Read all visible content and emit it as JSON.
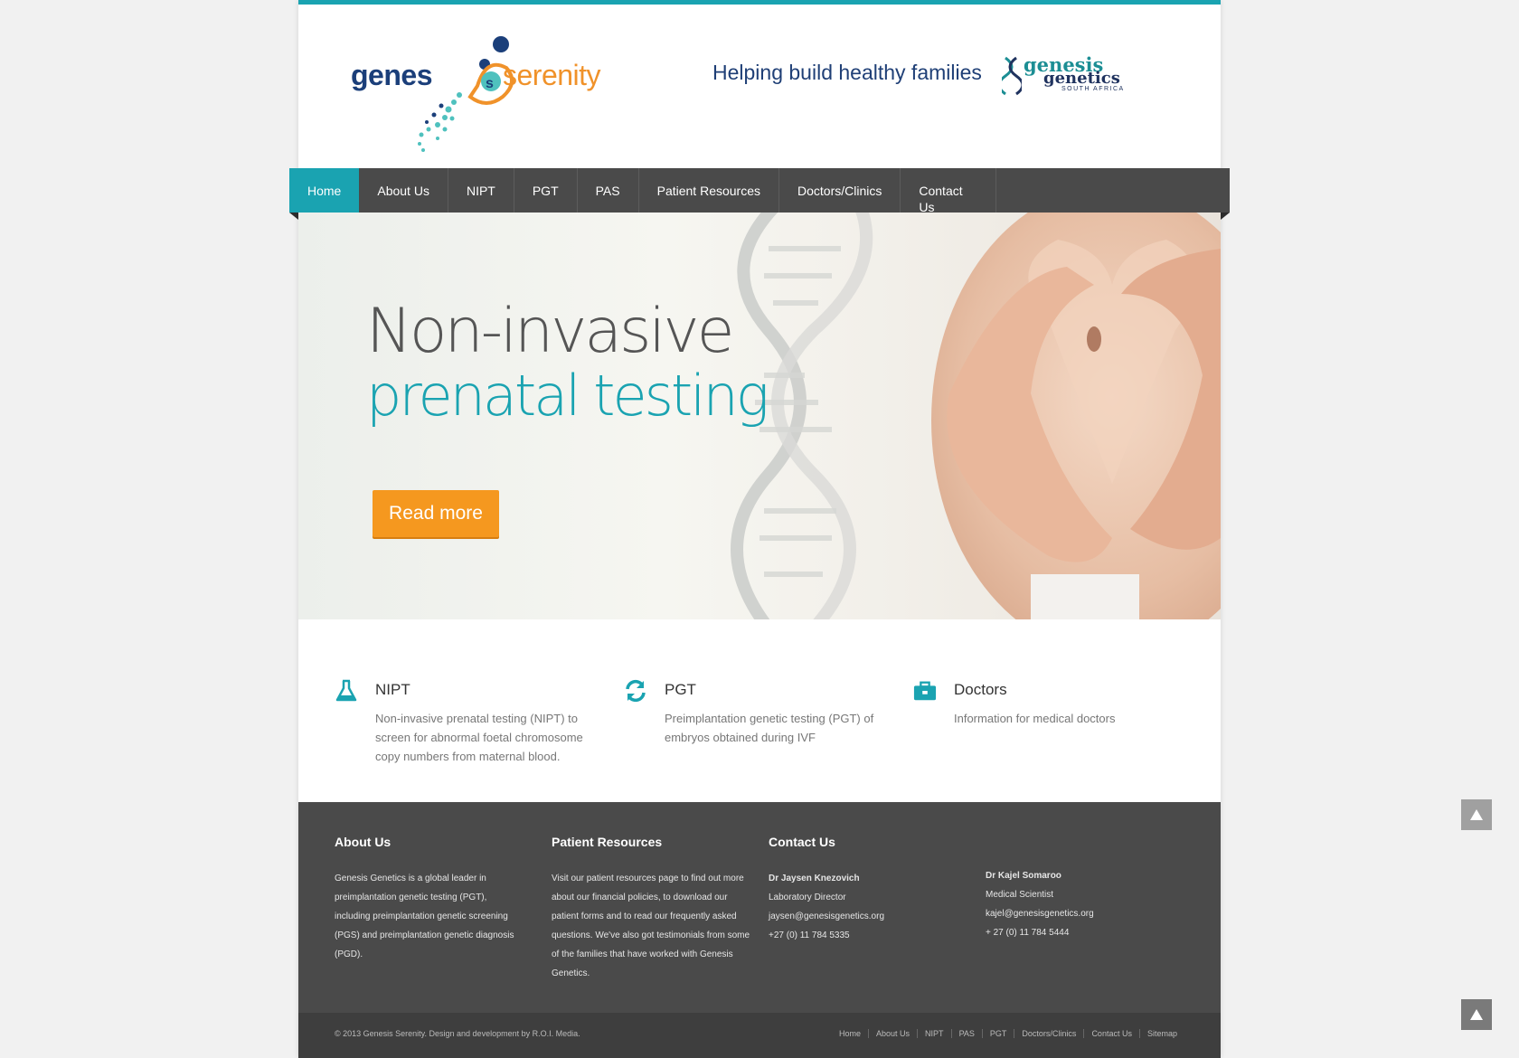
{
  "header": {
    "logo_text_left": "genes",
    "logo_text_right": "serenity",
    "tagline": "Helping build healthy families",
    "partner_logo_line1": "genesis",
    "partner_logo_line2": "genetics",
    "partner_logo_line3": "SOUTH AFRICA"
  },
  "nav": {
    "items": [
      {
        "label": "Home"
      },
      {
        "label": "About Us"
      },
      {
        "label": "NIPT"
      },
      {
        "label": "PGT"
      },
      {
        "label": "PAS"
      },
      {
        "label": "Patient Resources"
      },
      {
        "label": "Doctors/Clinics"
      },
      {
        "label": "Contact Us"
      }
    ]
  },
  "hero": {
    "title_line1": "Non-invasive",
    "title_line2": "prenatal testing",
    "button_label": "Read more"
  },
  "features": [
    {
      "icon": "flask-icon",
      "title": "NIPT",
      "text": "Non-invasive prenatal testing (NIPT) to screen for abnormal foetal chromosome copy numbers from maternal blood."
    },
    {
      "icon": "refresh-icon",
      "title": "PGT",
      "text": "Preimplantation genetic testing (PGT) of embryos obtained during IVF"
    },
    {
      "icon": "briefcase-icon",
      "title": "Doctors",
      "text": "Information for medical doctors"
    }
  ],
  "footer": {
    "about": {
      "title": "About Us",
      "text": "Genesis Genetics is a global leader in preimplantation genetic testing (PGT), including preimplantation genetic screening (PGS) and preimplantation genetic diagnosis (PGD)."
    },
    "resources": {
      "title": "Patient Resources",
      "text": "Visit our patient resources page to find out more about our financial policies, to download our patient forms and to read our frequently asked questions. We've also got testimonials from some of the families that have worked with Genesis Genetics."
    },
    "contact": {
      "title": "Contact Us",
      "person1": {
        "name": "Dr Jaysen Knezovich",
        "role": "Laboratory Director",
        "email": "jaysen@genesisgenetics.org",
        "phone": "+27 (0) 11 784 5335"
      },
      "person2": {
        "name": "Dr Kajel Somaroo",
        "role": "Medical Scientist",
        "email": "kajel@genesisgenetics.org",
        "phone": "+ 27 (0) 11 784 5444"
      }
    },
    "copyright": "© 2013 Genesis Serenity. Design and development by R.O.I. Media.",
    "links": [
      "Home",
      "About Us",
      "NIPT",
      "PAS",
      "PGT",
      "Doctors/Clinics",
      "Contact Us",
      "Sitemap"
    ]
  },
  "colors": {
    "accent": "#1aa3b1",
    "button": "#f5981f",
    "nav_bg": "#4a4a4a",
    "brand_navy": "#1f3f76"
  }
}
